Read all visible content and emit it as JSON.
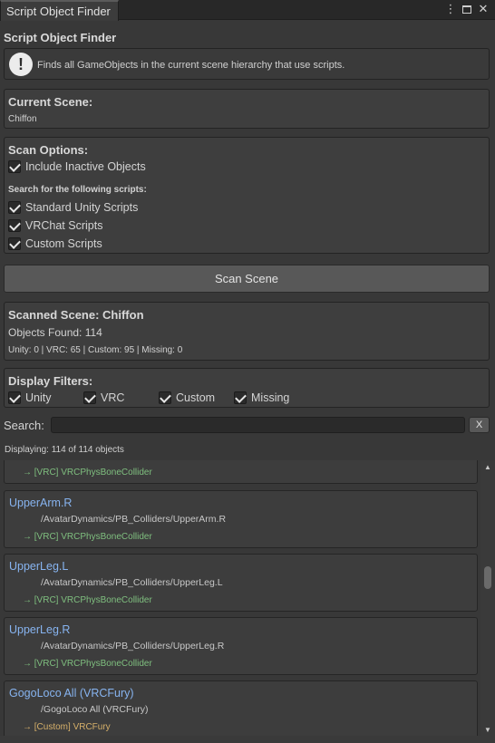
{
  "window": {
    "tab_title": "Script Object Finder",
    "icons": [
      "more-vertical-icon",
      "maximize-icon",
      "close-icon"
    ]
  },
  "title": "Script Object Finder",
  "help": {
    "icon_glyph": "!",
    "text": "Finds all GameObjects in the current scene hierarchy that use scripts."
  },
  "current_scene": {
    "label": "Current Scene:",
    "value": "Chiffon"
  },
  "scan_options": {
    "label": "Scan Options:",
    "include_inactive": {
      "label": "Include Inactive Objects",
      "checked": true
    },
    "search_heading": "Search for the following scripts:",
    "scripts": [
      {
        "label": "Standard Unity Scripts",
        "checked": true
      },
      {
        "label": "VRChat Scripts",
        "checked": true
      },
      {
        "label": "Custom Scripts",
        "checked": true
      }
    ]
  },
  "scan_button": "Scan Scene",
  "results": {
    "scanned_scene": "Scanned Scene: Chiffon",
    "objects_found": "Objects Found: 114",
    "breakdown": "Unity: 0 | VRC: 65 | Custom: 95 | Missing: 0"
  },
  "display_filters": {
    "label": "Display Filters:",
    "filters": [
      {
        "label": "Unity",
        "checked": true
      },
      {
        "label": "VRC",
        "checked": true
      },
      {
        "label": "Custom",
        "checked": true
      },
      {
        "label": "Missing",
        "checked": true
      }
    ]
  },
  "search": {
    "label": "Search:",
    "value": "",
    "placeholder": "",
    "clear_label": "X"
  },
  "displaying": "Displaying: 114 of 114 objects",
  "objects": [
    {
      "name": "",
      "path": "",
      "script": "→ [VRC] VRCPhysBoneCollider",
      "script_type": "vrc"
    },
    {
      "name": "UpperArm.R",
      "path": "/AvatarDynamics/PB_Colliders/UpperArm.R",
      "script": "→ [VRC] VRCPhysBoneCollider",
      "script_type": "vrc"
    },
    {
      "name": "UpperLeg.L",
      "path": "/AvatarDynamics/PB_Colliders/UpperLeg.L",
      "script": "→ [VRC] VRCPhysBoneCollider",
      "script_type": "vrc"
    },
    {
      "name": "UpperLeg.R",
      "path": "/AvatarDynamics/PB_Colliders/UpperLeg.R",
      "script": "→ [VRC] VRCPhysBoneCollider",
      "script_type": "vrc"
    },
    {
      "name": "GogoLoco All (VRCFury)",
      "path": "/GogoLoco All (VRCFury)",
      "script": "→ [Custom] VRCFury",
      "script_type": "custom"
    }
  ],
  "colors": {
    "background": "#383838",
    "object_name": "#87b4f0",
    "vrc_script": "#7fbf7f",
    "custom_script": "#d6b06a"
  },
  "scroll_position": 0.4
}
